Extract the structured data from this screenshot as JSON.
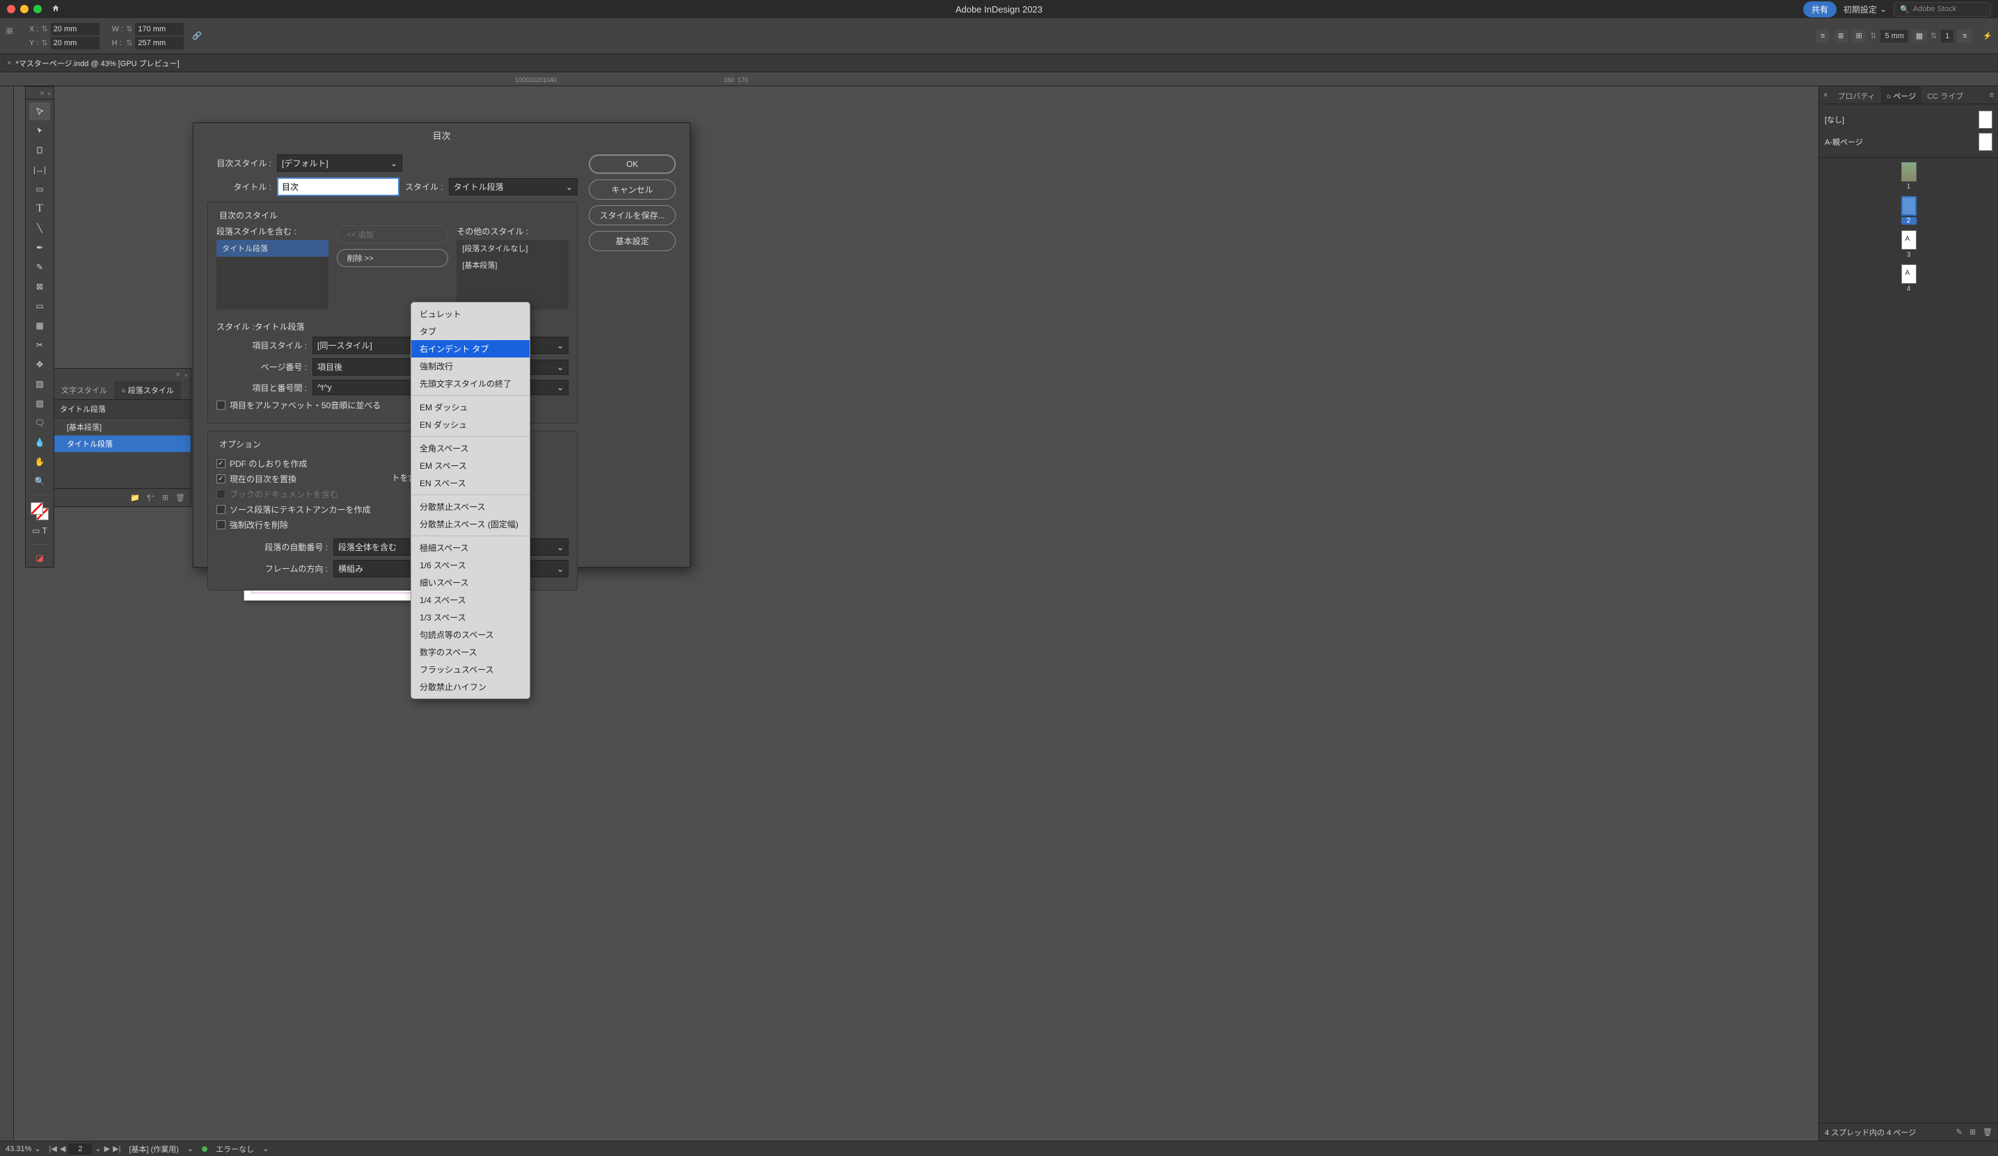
{
  "app_title": "Adobe InDesign 2023",
  "share_label": "共有",
  "preset_label": "初期設定",
  "stock_placeholder": "Adobe Stock",
  "control": {
    "x_label": "X :",
    "x_value": "20 mm",
    "y_label": "Y :",
    "y_value": "20 mm",
    "w_label": "W :",
    "w_value": "170 mm",
    "h_label": "H :",
    "h_value": "257 mm",
    "stroke_val": "5 mm",
    "page_num_field": "1"
  },
  "doc_tab": "*マスターページ.indd @ 43% [GPU プレビュー]",
  "dialog": {
    "title": "目次",
    "toc_style_label": "目次スタイル :",
    "toc_style_value": "[デフォルト]",
    "title_label": "タイトル :",
    "title_value": "目次",
    "style_label": "スタイル :",
    "style_value": "タイトル段落",
    "ok": "OK",
    "cancel": "キャンセル",
    "save_style": "スタイルを保存...",
    "basic_settings": "基本設定",
    "toc_styles_legend": "目次のスタイル",
    "para_include_label": "段落スタイルを含む :",
    "para_include_item": "タイトル段落",
    "add_btn": "<< 追加",
    "remove_btn": "削除 >>",
    "other_styles_label": "その他のスタイル :",
    "other_style_none": "[段落スタイルなし]",
    "other_style_basic": "[基本段落]",
    "style_section_label": "スタイル :タイトル段落",
    "entry_style_label": "項目スタイル :",
    "entry_style_value": "[同一スタイル]",
    "page_num_label": "ページ番号 :",
    "page_num_value": "項目後",
    "between_label": "項目と番号間 :",
    "between_value": "^t^y",
    "alpha_sort_label": "項目をアルファベット・50音順に並べる",
    "options_legend": "オプション",
    "opt_pdf_bookmark": "PDF のしおりを作成",
    "opt_replace_toc": "現在の目次を置換",
    "opt_book_docs": "ブックのドキュメントを含む",
    "opt_source_anchor": "ソース段落にテキストアンカーを作成",
    "opt_remove_forced": "強制改行を削除",
    "opt_include_hidden_tail": "トを含む",
    "para_numbering_label": "段落の自動番号 :",
    "para_numbering_value": "段落全体を含む",
    "frame_dir_label": "フレームの方向 :",
    "frame_dir_value": "横組み"
  },
  "ctxmenu": {
    "items_a": [
      "ビュレット",
      "タブ"
    ],
    "highlighted": "右インデント タブ",
    "items_b": [
      "強制改行",
      "先頭文字スタイルの終了"
    ],
    "items_c": [
      "EM ダッシュ",
      "EN ダッシュ"
    ],
    "items_d": [
      "全角スペース",
      "EM スペース",
      "EN スペース"
    ],
    "items_e": [
      "分散禁止スペース",
      "分散禁止スペース (固定幅)"
    ],
    "items_f": [
      "極細スペース",
      "1/6 スペース",
      "細いスペース",
      "1/4 スペース",
      "1/3 スペース",
      "句読点等のスペース",
      "数字のスペース",
      "フラッシュスペース",
      "分散禁止ハイフン"
    ]
  },
  "styles_panel": {
    "tab_char": "文字スタイル",
    "tab_para": "段落スタイル",
    "header": "タイトル段落",
    "item_basic": "[基本段落]",
    "item_title": "タイトル段落"
  },
  "right_panel": {
    "tab_properties": "プロパティ",
    "tab_pages": "ページ",
    "tab_cc": "CC ライブ",
    "master_none": "[なし]",
    "master_a": "A-親ページ",
    "page_labels": [
      "1",
      "2",
      "3",
      "4"
    ],
    "footer_text": "4 スプレッド内の 4 ページ"
  },
  "status": {
    "zoom": "43.31%",
    "page": "2",
    "preflight_profile": "[基本] (作業用)",
    "errors": "エラーなし"
  }
}
